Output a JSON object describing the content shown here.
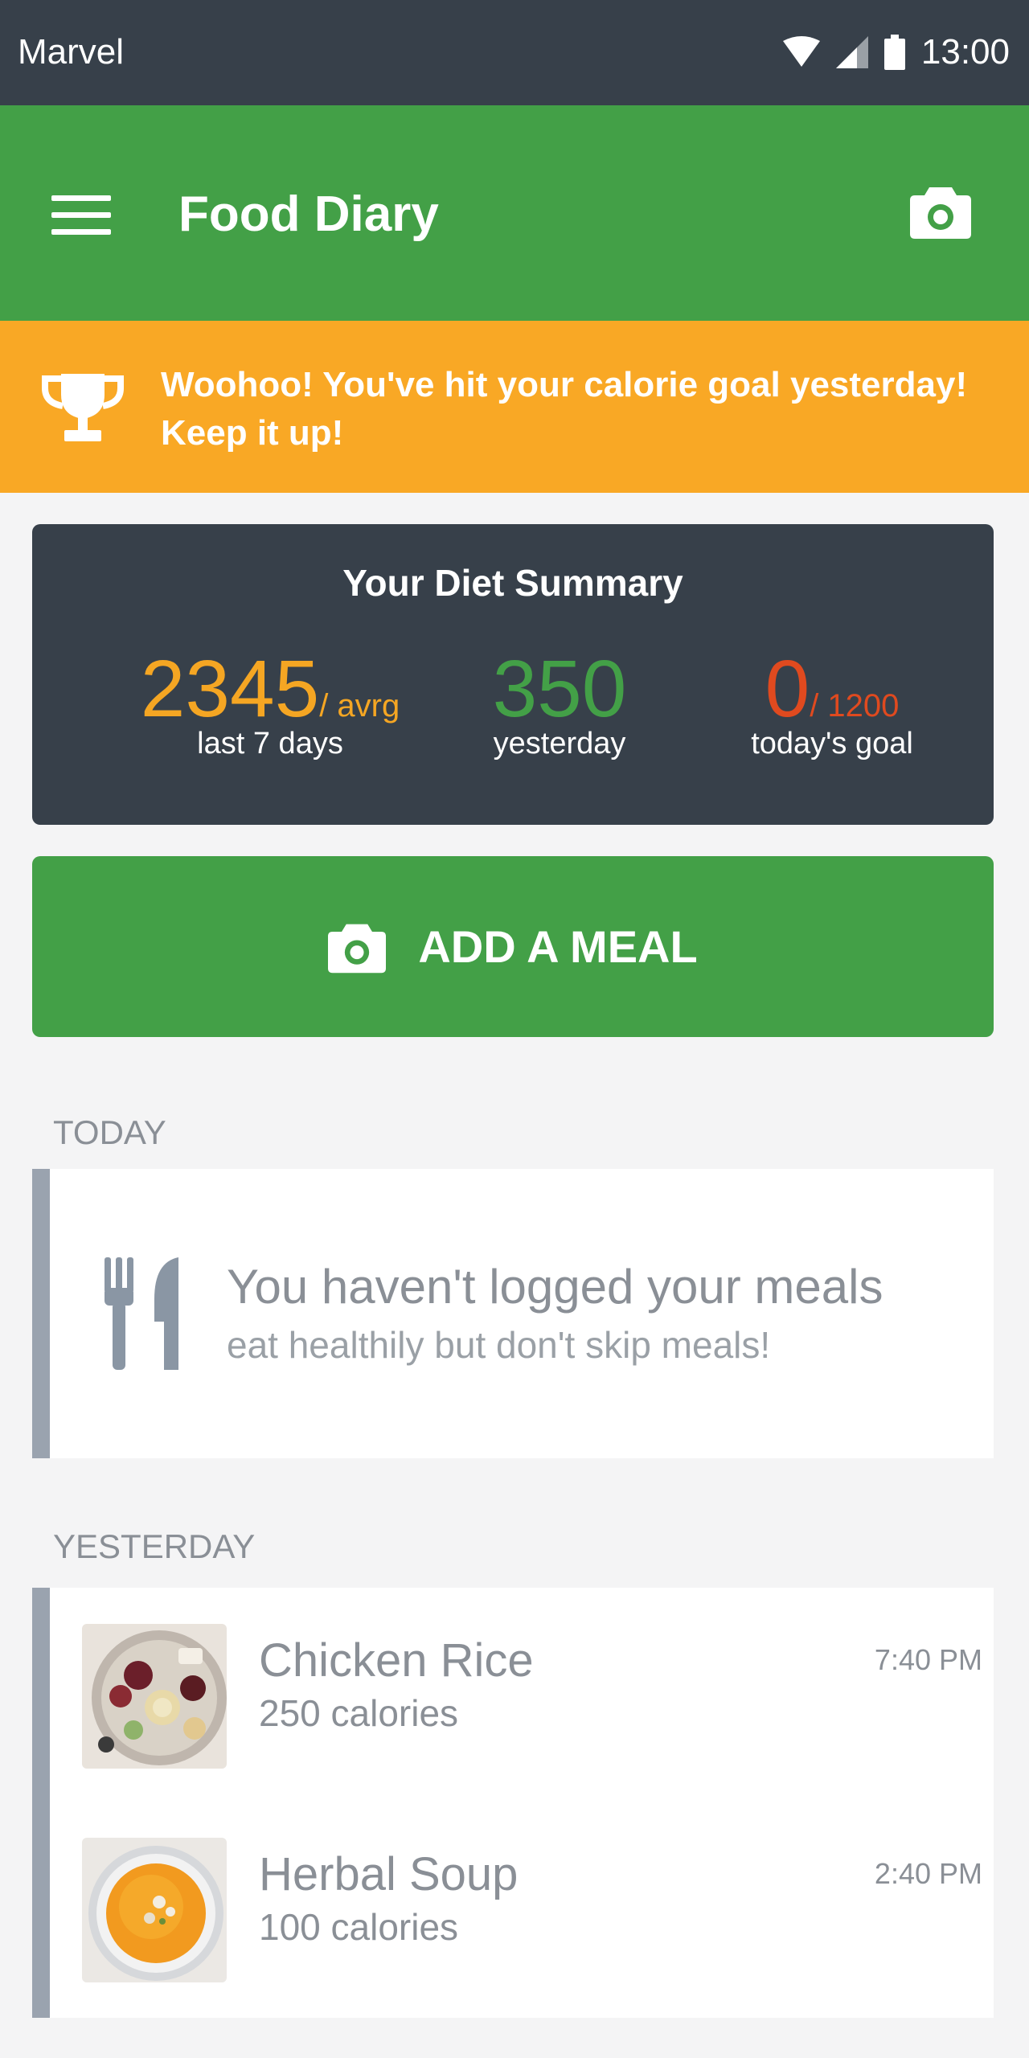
{
  "status_bar": {
    "carrier": "Marvel",
    "time": "13:00"
  },
  "app_bar": {
    "title": "Food Diary"
  },
  "banner": {
    "message": "Woohoo! You've hit your calorie goal yesterday! Keep it up!"
  },
  "summary": {
    "title": "Your Diet Summary",
    "average": {
      "value": "2345",
      "suffix": "/ avrg",
      "label": "last 7 days"
    },
    "yesterday": {
      "value": "350",
      "label": "yesterday"
    },
    "today": {
      "value": "0",
      "suffix": "/ 1200",
      "label": "today's goal"
    }
  },
  "add_meal": {
    "label": "ADD A MEAL"
  },
  "today": {
    "label": "TODAY",
    "empty_title": "You haven't logged your meals",
    "empty_subtitle": "eat healthily but don't skip meals!"
  },
  "yesterday": {
    "label": "YESTERDAY",
    "meals": [
      {
        "name": "Chicken Rice",
        "calories": "250 calories",
        "time": "7:40 PM"
      },
      {
        "name": "Herbal Soup",
        "calories": "100 calories",
        "time": "2:40 PM"
      }
    ]
  },
  "colors": {
    "status_bar": "#37404a",
    "primary_green": "#43a047",
    "banner_orange": "#f9a825",
    "average_orange": "#f5a623",
    "today_red": "#e04a1f"
  }
}
